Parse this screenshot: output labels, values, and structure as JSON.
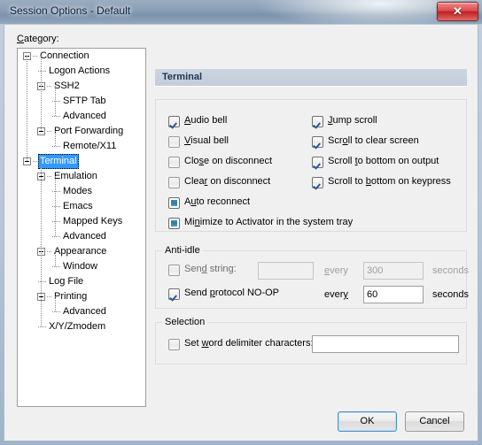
{
  "window": {
    "title": "Session Options - Default",
    "close_glyph": "✕",
    "close_label": "Close"
  },
  "category": {
    "label": "Category:",
    "label_accel": "C",
    "tree": [
      {
        "label": "Connection",
        "depth": 0,
        "expander": "minus",
        "selected": false
      },
      {
        "label": "Logon Actions",
        "depth": 1,
        "expander": "none",
        "selected": false
      },
      {
        "label": "SSH2",
        "depth": 1,
        "expander": "minus",
        "selected": false
      },
      {
        "label": "SFTP Tab",
        "depth": 2,
        "expander": "none",
        "selected": false
      },
      {
        "label": "Advanced",
        "depth": 2,
        "expander": "none",
        "selected": false
      },
      {
        "label": "Port Forwarding",
        "depth": 1,
        "expander": "minus",
        "selected": false
      },
      {
        "label": "Remote/X11",
        "depth": 2,
        "expander": "none",
        "selected": false
      },
      {
        "label": "Terminal",
        "depth": 0,
        "expander": "minus",
        "selected": true
      },
      {
        "label": "Emulation",
        "depth": 1,
        "expander": "minus",
        "selected": false
      },
      {
        "label": "Modes",
        "depth": 2,
        "expander": "none",
        "selected": false
      },
      {
        "label": "Emacs",
        "depth": 2,
        "expander": "none",
        "selected": false
      },
      {
        "label": "Mapped Keys",
        "depth": 2,
        "expander": "none",
        "selected": false
      },
      {
        "label": "Advanced",
        "depth": 2,
        "expander": "none",
        "selected": false
      },
      {
        "label": "Appearance",
        "depth": 1,
        "expander": "minus",
        "selected": false
      },
      {
        "label": "Window",
        "depth": 2,
        "expander": "none",
        "selected": false
      },
      {
        "label": "Log File",
        "depth": 1,
        "expander": "none",
        "selected": false
      },
      {
        "label": "Printing",
        "depth": 1,
        "expander": "minus",
        "selected": false
      },
      {
        "label": "Advanced",
        "depth": 2,
        "expander": "none",
        "selected": false
      },
      {
        "label": "X/Y/Zmodem",
        "depth": 1,
        "expander": "none",
        "selected": false
      }
    ]
  },
  "pane": {
    "title": "Terminal",
    "general": {
      "left_column": [
        {
          "label": "Audio bell",
          "accel": "A",
          "state": "checked"
        },
        {
          "label": "Visual bell",
          "accel": "V",
          "state": "unchecked"
        },
        {
          "label": "Close on disconnect",
          "accel": "s",
          "state": "unchecked"
        },
        {
          "label": "Clear on disconnect",
          "accel": "r",
          "state": "unchecked"
        }
      ],
      "right_column": [
        {
          "label": "Jump scroll",
          "accel": "J",
          "state": "checked"
        },
        {
          "label": "Scroll to clear screen",
          "accel": "o",
          "state": "checked"
        },
        {
          "label": "Scroll to bottom on output",
          "accel": "t",
          "state": "checked"
        },
        {
          "label": "Scroll to bottom on keypress",
          "accel": "b",
          "state": "checked"
        }
      ],
      "full_width": [
        {
          "label": "Auto reconnect",
          "accel": "u",
          "state": "mixed"
        },
        {
          "label": "Minimize to Activator in the system tray",
          "accel": "n",
          "state": "mixed"
        }
      ]
    },
    "anti_idle": {
      "title": "Anti-idle",
      "send_string": {
        "label": "Send string:",
        "accel": "d",
        "state": "unchecked",
        "enabled": false,
        "value": "",
        "every_label": "every",
        "every_accel": "e",
        "interval": "300",
        "seconds_label": "seconds"
      },
      "send_noop": {
        "label": "Send protocol NO-OP",
        "accel": "p",
        "state": "checked",
        "enabled": true,
        "every_label": "every",
        "every_accel": "y",
        "interval": "60",
        "seconds_label": "seconds"
      }
    },
    "selection": {
      "title": "Selection",
      "set_delimiters": {
        "label": "Set word delimiter characters:",
        "accel": "w",
        "state": "unchecked",
        "value": ""
      }
    }
  },
  "footer": {
    "ok_label": "OK",
    "cancel_label": "Cancel"
  }
}
